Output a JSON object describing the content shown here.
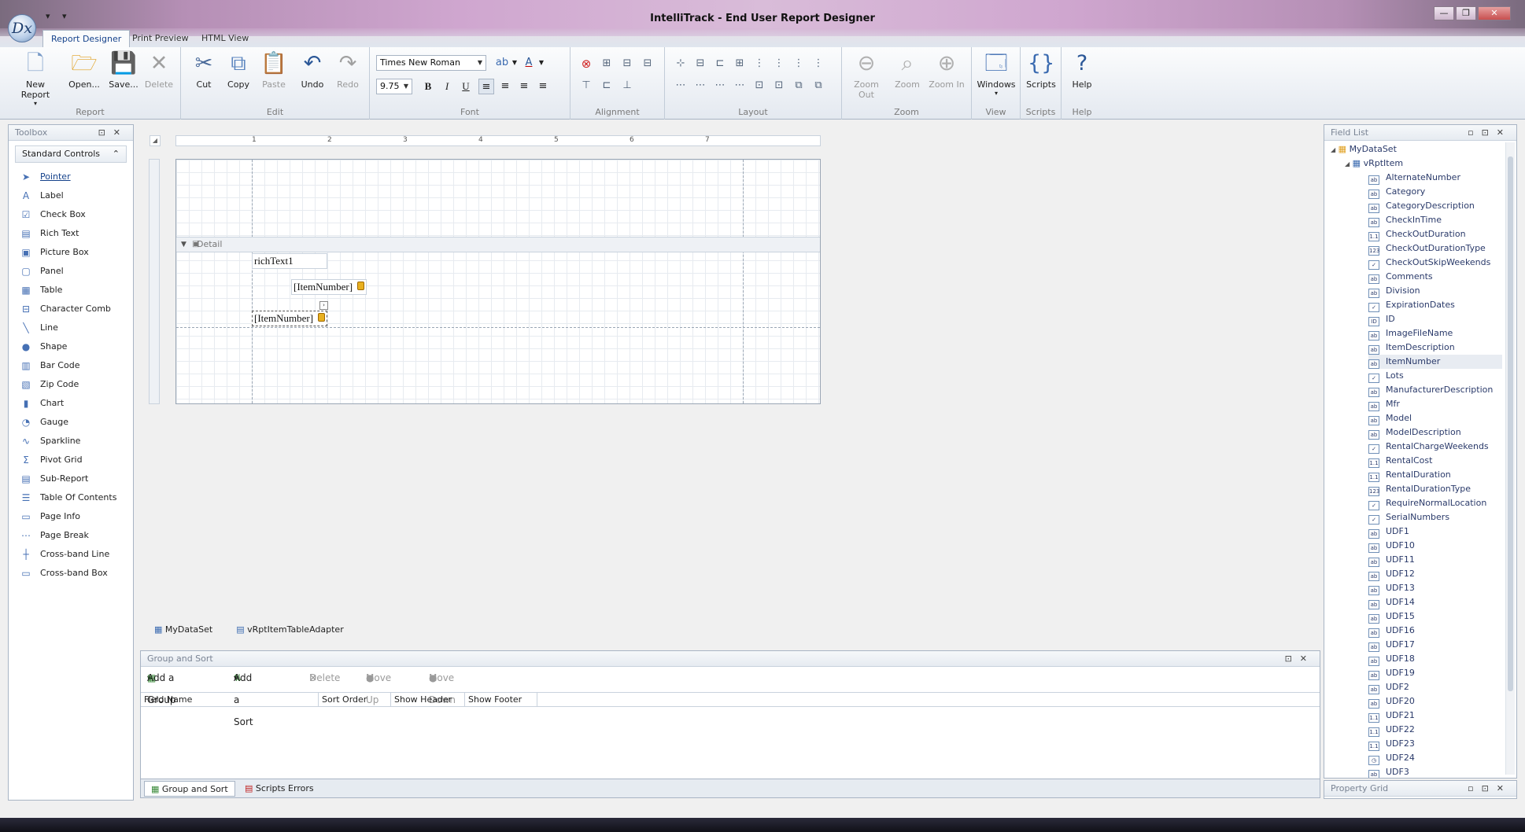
{
  "app": {
    "title": "IntelliTrack - End User Report Designer",
    "logo_text": "Dx",
    "qat_glyphs": "▾ ▾"
  },
  "window_controls": {
    "minimize": "—",
    "restore": "❐",
    "close": "✕"
  },
  "ribbon_tabs": [
    "Report Designer",
    "Print Preview",
    "HTML View"
  ],
  "ribbon": {
    "report": {
      "label": "Report",
      "new": "New Report",
      "open": "Open...",
      "save": "Save...",
      "delete": "Delete"
    },
    "edit": {
      "label": "Edit",
      "cut": "Cut",
      "copy": "Copy",
      "paste": "Paste",
      "undo": "Undo",
      "redo": "Redo"
    },
    "font": {
      "label": "Font",
      "family": "Times New Roman",
      "size": "9.75",
      "bold": "B",
      "italic": "I",
      "underline": "U"
    },
    "alignment": {
      "label": "Alignment"
    },
    "layout": {
      "label": "Layout"
    },
    "zoom": {
      "label": "Zoom",
      "zoom_out": "Zoom Out",
      "zoom": "Zoom",
      "zoom_in": "Zoom In"
    },
    "view": {
      "label": "View",
      "windows": "Windows"
    },
    "scripts": {
      "label": "Scripts",
      "scripts": "Scripts"
    },
    "help": {
      "label": "Help",
      "help": "Help"
    }
  },
  "toolbox": {
    "title": "Toolbox",
    "category": "Standard Controls",
    "items": [
      {
        "label": "Pointer",
        "icon": "pointer-icon",
        "glyph": "➤"
      },
      {
        "label": "Label",
        "icon": "label-icon",
        "glyph": "A"
      },
      {
        "label": "Check Box",
        "icon": "check-box-icon",
        "glyph": "☑"
      },
      {
        "label": "Rich Text",
        "icon": "rich-text-icon",
        "glyph": "▤"
      },
      {
        "label": "Picture Box",
        "icon": "picture-box-icon",
        "glyph": "▣"
      },
      {
        "label": "Panel",
        "icon": "panel-icon",
        "glyph": "▢"
      },
      {
        "label": "Table",
        "icon": "table-icon",
        "glyph": "▦"
      },
      {
        "label": "Character Comb",
        "icon": "character-comb-icon",
        "glyph": "⊟"
      },
      {
        "label": "Line",
        "icon": "line-icon",
        "glyph": "╲"
      },
      {
        "label": "Shape",
        "icon": "shape-icon",
        "glyph": "●"
      },
      {
        "label": "Bar Code",
        "icon": "bar-code-icon",
        "glyph": "▥"
      },
      {
        "label": "Zip Code",
        "icon": "zip-code-icon",
        "glyph": "▧"
      },
      {
        "label": "Chart",
        "icon": "chart-icon",
        "glyph": "▮"
      },
      {
        "label": "Gauge",
        "icon": "gauge-icon",
        "glyph": "◔"
      },
      {
        "label": "Sparkline",
        "icon": "sparkline-icon",
        "glyph": "∿"
      },
      {
        "label": "Pivot Grid",
        "icon": "pivot-grid-icon",
        "glyph": "Σ"
      },
      {
        "label": "Sub-Report",
        "icon": "sub-report-icon",
        "glyph": "▤"
      },
      {
        "label": "Table Of Contents",
        "icon": "table-of-contents-icon",
        "glyph": "☰"
      },
      {
        "label": "Page Info",
        "icon": "page-info-icon",
        "glyph": "▭"
      },
      {
        "label": "Page Break",
        "icon": "page-break-icon",
        "glyph": "⋯"
      },
      {
        "label": "Cross-band Line",
        "icon": "cross-band-line-icon",
        "glyph": "┼"
      },
      {
        "label": "Cross-band Box",
        "icon": "cross-band-box-icon",
        "glyph": "▭"
      }
    ]
  },
  "designer": {
    "ruler_marks": [
      "1",
      "2",
      "3",
      "4",
      "5",
      "6",
      "7"
    ],
    "band_label": "Detail",
    "controls": {
      "rich_text": "richText1",
      "field1": "[ItemNumber]",
      "field2": "[ItemNumber]"
    }
  },
  "component_tray": [
    "MyDataSet",
    "vRptItemTableAdapter"
  ],
  "group_sort": {
    "title": "Group and Sort",
    "toolbar": {
      "add_group": "Add a Group",
      "add_sort": "Add a Sort",
      "delete": "Delete",
      "move_up": "Move Up",
      "move_down": "Move Down"
    },
    "columns": [
      "Field Name",
      "Sort Order",
      "Show Header",
      "Show Footer"
    ]
  },
  "bottom_tabs": [
    "Group and Sort",
    "Scripts Errors"
  ],
  "field_list": {
    "title": "Field List",
    "dataset": "MyDataSet",
    "table": "vRptItem",
    "selected": "ItemNumber",
    "fields": [
      {
        "name": "AlternateNumber",
        "type": "ab"
      },
      {
        "name": "Category",
        "type": "ab"
      },
      {
        "name": "CategoryDescription",
        "type": "ab"
      },
      {
        "name": "CheckInTime",
        "type": "ab"
      },
      {
        "name": "CheckOutDuration",
        "type": "1.1"
      },
      {
        "name": "CheckOutDurationType",
        "type": "123"
      },
      {
        "name": "CheckOutSkipWeekends",
        "type": "✓"
      },
      {
        "name": "Comments",
        "type": "ab"
      },
      {
        "name": "Division",
        "type": "ab"
      },
      {
        "name": "ExpirationDates",
        "type": "✓"
      },
      {
        "name": "ID",
        "type": "ID"
      },
      {
        "name": "ImageFileName",
        "type": "ab"
      },
      {
        "name": "ItemDescription",
        "type": "ab"
      },
      {
        "name": "ItemNumber",
        "type": "ab"
      },
      {
        "name": "Lots",
        "type": "✓"
      },
      {
        "name": "ManufacturerDescription",
        "type": "ab"
      },
      {
        "name": "Mfr",
        "type": "ab"
      },
      {
        "name": "Model",
        "type": "ab"
      },
      {
        "name": "ModelDescription",
        "type": "ab"
      },
      {
        "name": "RentalChargeWeekends",
        "type": "✓"
      },
      {
        "name": "RentalCost",
        "type": "1.1"
      },
      {
        "name": "RentalDuration",
        "type": "1.1"
      },
      {
        "name": "RentalDurationType",
        "type": "123"
      },
      {
        "name": "RequireNormalLocation",
        "type": "✓"
      },
      {
        "name": "SerialNumbers",
        "type": "✓"
      },
      {
        "name": "UDF1",
        "type": "ab"
      },
      {
        "name": "UDF10",
        "type": "ab"
      },
      {
        "name": "UDF11",
        "type": "ab"
      },
      {
        "name": "UDF12",
        "type": "ab"
      },
      {
        "name": "UDF13",
        "type": "ab"
      },
      {
        "name": "UDF14",
        "type": "ab"
      },
      {
        "name": "UDF15",
        "type": "ab"
      },
      {
        "name": "UDF16",
        "type": "ab"
      },
      {
        "name": "UDF17",
        "type": "ab"
      },
      {
        "name": "UDF18",
        "type": "ab"
      },
      {
        "name": "UDF19",
        "type": "ab"
      },
      {
        "name": "UDF2",
        "type": "ab"
      },
      {
        "name": "UDF20",
        "type": "ab"
      },
      {
        "name": "UDF21",
        "type": "1.1"
      },
      {
        "name": "UDF22",
        "type": "1.1"
      },
      {
        "name": "UDF23",
        "type": "1.1"
      },
      {
        "name": "UDF24",
        "type": "◷"
      },
      {
        "name": "UDF3",
        "type": "ab"
      }
    ]
  },
  "property_grid": {
    "title": "Property Grid"
  },
  "panel_glyphs": {
    "pin": "⊡",
    "float": "▫",
    "close": "✕"
  },
  "colors": {
    "accent": "#15428b",
    "ribbon_bg": "#e4e9f0",
    "selected_row": "#e8ecf2"
  }
}
